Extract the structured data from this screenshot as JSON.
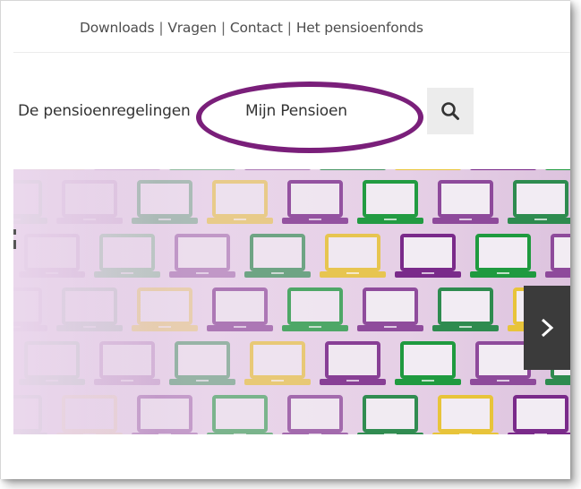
{
  "header": {
    "top_links": [
      {
        "label": "Downloads"
      },
      {
        "label": "Vragen"
      },
      {
        "label": "Contact"
      },
      {
        "label": "Het pensioenfonds"
      }
    ],
    "separator": "|"
  },
  "nav": {
    "items": [
      {
        "label": "De pensioenregelingen"
      },
      {
        "label": "Mijn Pensioen"
      }
    ],
    "search_icon": "search-icon"
  },
  "annotation": {
    "color": "#7a1f7a"
  },
  "hero": {
    "next_icon": "chevron-right-icon",
    "laptop_colors": [
      "#8e4a9b",
      "#2e8b4f",
      "#e8c43a",
      "#7a2a8a",
      "#1f9a3f"
    ]
  }
}
